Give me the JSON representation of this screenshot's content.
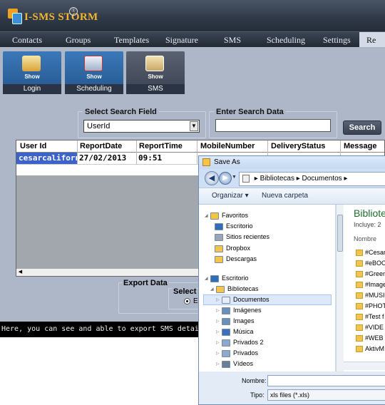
{
  "app": {
    "title": "I-SMS STORM",
    "badge": "®"
  },
  "nav": {
    "items": [
      "Contacts",
      "Groups",
      "Templates",
      "Signature",
      "SMS",
      "Scheduling",
      "Settings",
      "Re"
    ]
  },
  "toolbar": {
    "tiles": [
      {
        "show": "Show",
        "caption": "Login"
      },
      {
        "show": "Show",
        "caption": "Scheduling"
      },
      {
        "show": "Show",
        "caption": "SMS"
      }
    ]
  },
  "search": {
    "field_title": "Select Search Field",
    "field_value": "UserId",
    "data_title": "Enter Search Data",
    "data_value": "",
    "button_label": "Search"
  },
  "grid": {
    "columns": [
      "User Id",
      "ReportDate",
      "ReportTime",
      "MobileNumber",
      "DeliveryStatus",
      "Message"
    ],
    "rows": [
      [
        "cesarcalifornia",
        "27/02/2013",
        "09:51"
      ]
    ]
  },
  "export": {
    "title": "Export Data",
    "select_title": "Select",
    "radio_label": "E"
  },
  "status": {
    "text": "Here, you can see and able to export SMS details to exte"
  },
  "dialog": {
    "title": "Save As",
    "address": [
      "Bibliotecas",
      "Documentos"
    ],
    "commands": {
      "organize": "Organizar ▾",
      "new_folder": "Nueva carpeta"
    },
    "tree": [
      {
        "label": "Favoritos",
        "icon": "star-icon",
        "color": "#f5c542"
      },
      {
        "label": "Escritorio",
        "icon": "desktop-icon",
        "color": "#2f6fb8"
      },
      {
        "label": "Sitios recientes",
        "icon": "recent-icon",
        "color": "#9aa6b4"
      },
      {
        "label": "Dropbox",
        "icon": "folder-icon",
        "color": "#f2c54e"
      },
      {
        "label": "Descargas",
        "icon": "download-folder-icon",
        "color": "#f2c54e"
      },
      {
        "label": "Escritorio",
        "icon": "desktop-icon",
        "color": "#2f6fb8"
      },
      {
        "label": "Bibliotecas",
        "icon": "library-icon",
        "color": "#f2c54e"
      },
      {
        "label": "Documentos",
        "icon": "documents-icon",
        "color": "#e8eef7"
      },
      {
        "label": "Imágenes",
        "icon": "pictures-icon",
        "color": "#6a8fb8"
      },
      {
        "label": "Images",
        "icon": "images-icon",
        "color": "#6a8fb8"
      },
      {
        "label": "Música",
        "icon": "music-icon",
        "color": "#3a6fc2"
      },
      {
        "label": "Privados 2",
        "icon": "library-icon",
        "color": "#8ea9cc"
      },
      {
        "label": "Privados",
        "icon": "library-icon",
        "color": "#8ea9cc"
      },
      {
        "label": "Vídeos",
        "icon": "videos-icon",
        "color": "#6a7e95"
      }
    ],
    "content": {
      "title": "Bibliote",
      "subtitle": "Incluye: 2",
      "column": "Nombre",
      "files": [
        "#Cesar",
        "#eBOO",
        "#Green",
        "#Image",
        "#MUSI",
        "#PHOT",
        "#Test f",
        "#VIDE",
        "#WEB R",
        "AktivM"
      ]
    },
    "form": {
      "name_label": "Nombre:",
      "name_value": "",
      "type_label": "Tipo:",
      "type_value": "xls files (*.xls)"
    }
  }
}
